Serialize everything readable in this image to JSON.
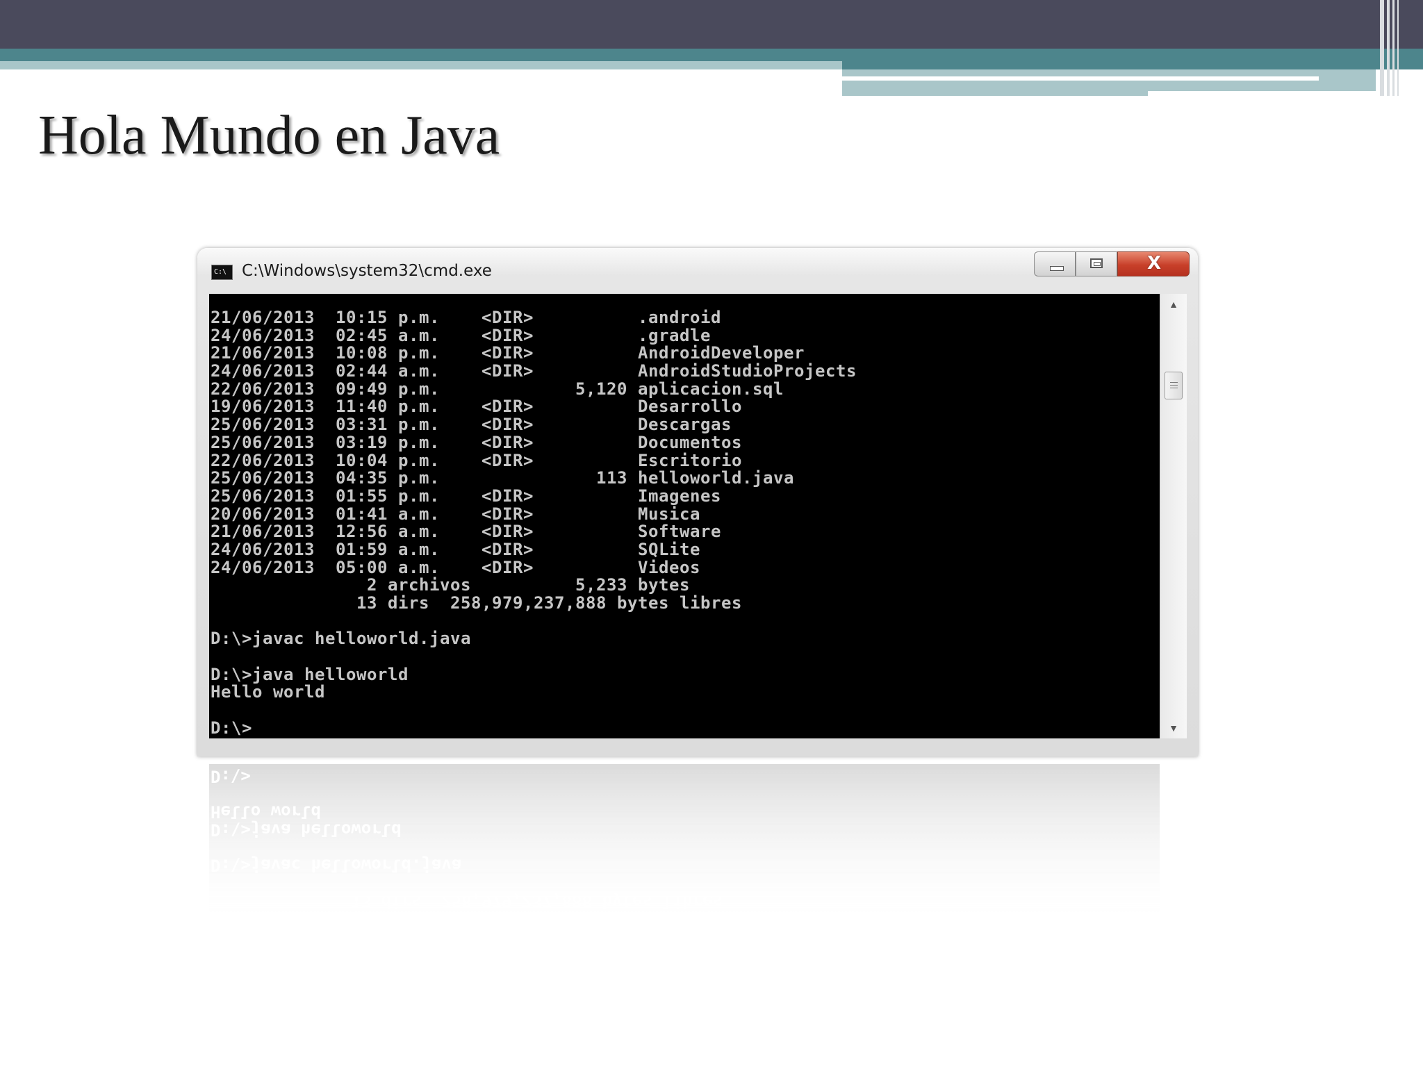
{
  "slide": {
    "title": "Hola Mundo en Java"
  },
  "window": {
    "title": "C:\\Windows\\system32\\cmd.exe",
    "icon": "cmd-icon",
    "icon_text": "C:\\",
    "controls": {
      "minimize": "minimize-icon",
      "maximize": "maximize-icon",
      "close": "close-icon",
      "close_glyph": "X"
    }
  },
  "console": {
    "lines": [
      "21/06/2013  10:15 p.m.    <DIR>          .android",
      "24/06/2013  02:45 a.m.    <DIR>          .gradle",
      "21/06/2013  10:08 p.m.    <DIR>          AndroidDeveloper",
      "24/06/2013  02:44 a.m.    <DIR>          AndroidStudioProjects",
      "22/06/2013  09:49 p.m.             5,120 aplicacion.sql",
      "19/06/2013  11:40 p.m.    <DIR>          Desarrollo",
      "25/06/2013  03:31 p.m.    <DIR>          Descargas",
      "25/06/2013  03:19 p.m.    <DIR>          Documentos",
      "22/06/2013  10:04 p.m.    <DIR>          Escritorio",
      "25/06/2013  04:35 p.m.               113 helloworld.java",
      "25/06/2013  01:55 p.m.    <DIR>          Imagenes",
      "20/06/2013  01:41 a.m.    <DIR>          Musica",
      "21/06/2013  12:56 a.m.    <DIR>          Software",
      "24/06/2013  01:59 a.m.    <DIR>          SQLite",
      "24/06/2013  05:00 a.m.    <DIR>          Videos",
      "               2 archivos          5,233 bytes",
      "              13 dirs  258,979,237,888 bytes libres",
      "",
      "D:\\>javac helloworld.java",
      "",
      "D:\\>java helloworld",
      "Hello world",
      "",
      "D:\\>"
    ]
  },
  "scrollbar": {
    "up_arrow": "▲",
    "down_arrow": "▼"
  },
  "colors": {
    "console_bg": "#000000",
    "console_text": "#c6c6c6",
    "header_dark": "#4a4a5c",
    "header_teal": "#4d858c",
    "close_red": "#c8402a"
  }
}
